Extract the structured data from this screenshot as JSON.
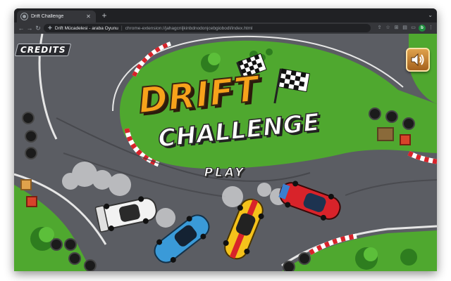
{
  "browser": {
    "tab": {
      "title": "Drift Challenge",
      "close_icon": "close-icon"
    },
    "new_tab_label": "+",
    "omnibox": {
      "page_title": "Drift Mücadelesi - araba Oyunu",
      "separator": "|",
      "url": "chrome-extension://jahagcnljkinbdnodonjcebgiobodl/index.html"
    }
  },
  "game": {
    "credits_label": "CREDITS",
    "title_line1": "DRIFT",
    "title_line2": "CHALLENGE",
    "play_label": "PLAY",
    "sound_icon": "speaker-icon"
  },
  "colors": {
    "grass": "#4fa82f",
    "asphalt": "#5b5d63",
    "title_orange": "#f7a21b",
    "curb_red": "#d8232a"
  }
}
